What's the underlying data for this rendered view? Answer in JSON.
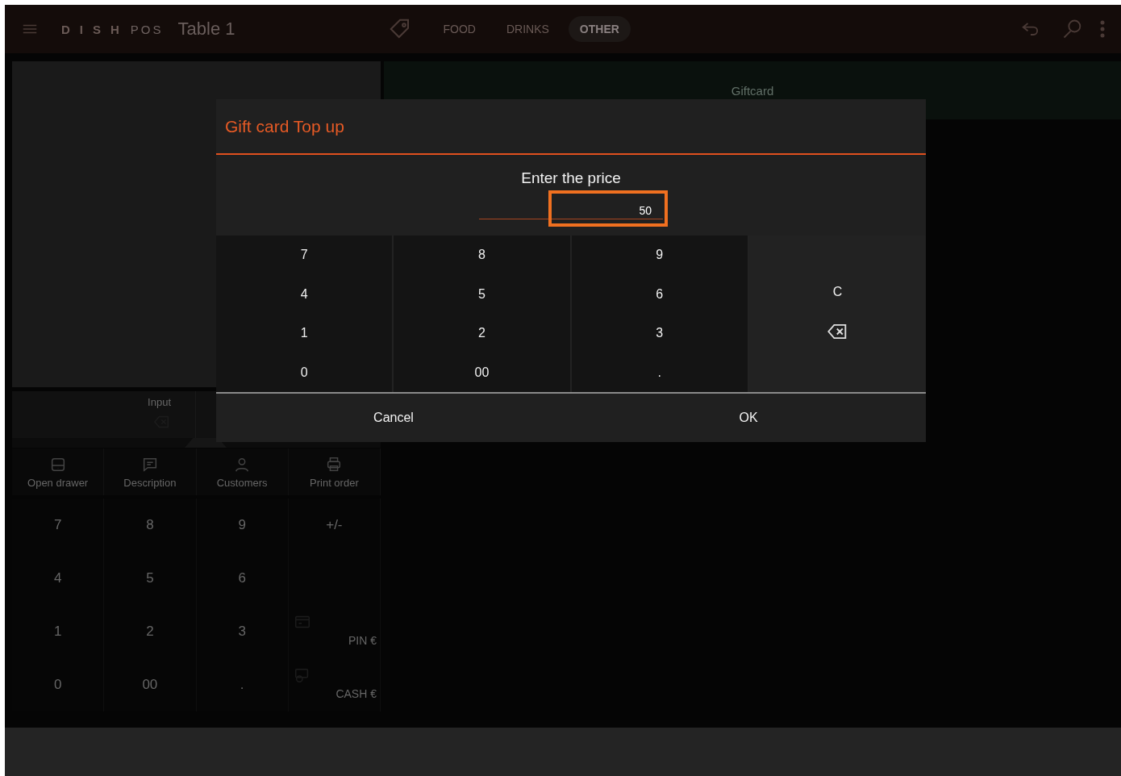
{
  "header": {
    "brand": "DISH",
    "brand_suffix": "POS",
    "title": "Table 1",
    "tabs": [
      {
        "label": "FOOD",
        "selected": false
      },
      {
        "label": "DRINKS",
        "selected": false
      },
      {
        "label": "OTHER",
        "selected": true
      }
    ]
  },
  "giftcard_tile": {
    "label": "Giftcard"
  },
  "input_panel": {
    "label": "Input"
  },
  "actions": [
    {
      "label": "Open drawer",
      "kind": "drawer"
    },
    {
      "label": "Description",
      "kind": "description"
    },
    {
      "label": "Customers",
      "kind": "customers"
    },
    {
      "label": "Print order",
      "kind": "print"
    }
  ],
  "keypad": [
    {
      "label": "7",
      "kind": "digit"
    },
    {
      "label": "8",
      "kind": "digit"
    },
    {
      "label": "9",
      "kind": "digit"
    },
    {
      "label": "+/-",
      "kind": "digit"
    },
    {
      "label": "4",
      "kind": "digit"
    },
    {
      "label": "5",
      "kind": "digit"
    },
    {
      "label": "6",
      "kind": "digit"
    },
    {
      "kind": "blank"
    },
    {
      "label": "1",
      "kind": "digit"
    },
    {
      "label": "2",
      "kind": "digit"
    },
    {
      "label": "3",
      "kind": "digit"
    },
    {
      "label": "PIN €",
      "kind": "card"
    },
    {
      "label": "0",
      "kind": "digit"
    },
    {
      "label": "00",
      "kind": "digit"
    },
    {
      "label": ".",
      "kind": "digit"
    },
    {
      "label": "CASH €",
      "kind": "cash"
    }
  ],
  "dialog": {
    "title": "Gift card Top up",
    "prompt": "Enter the price",
    "value": "50",
    "keys": [
      "7",
      "8",
      "9",
      "4",
      "5",
      "6",
      "1",
      "2",
      "3",
      "0",
      "00",
      "."
    ],
    "side_keys": [
      {
        "kind": "clear",
        "label": "C"
      },
      {
        "kind": "backspace"
      }
    ],
    "buttons": [
      "Cancel",
      "OK"
    ]
  }
}
